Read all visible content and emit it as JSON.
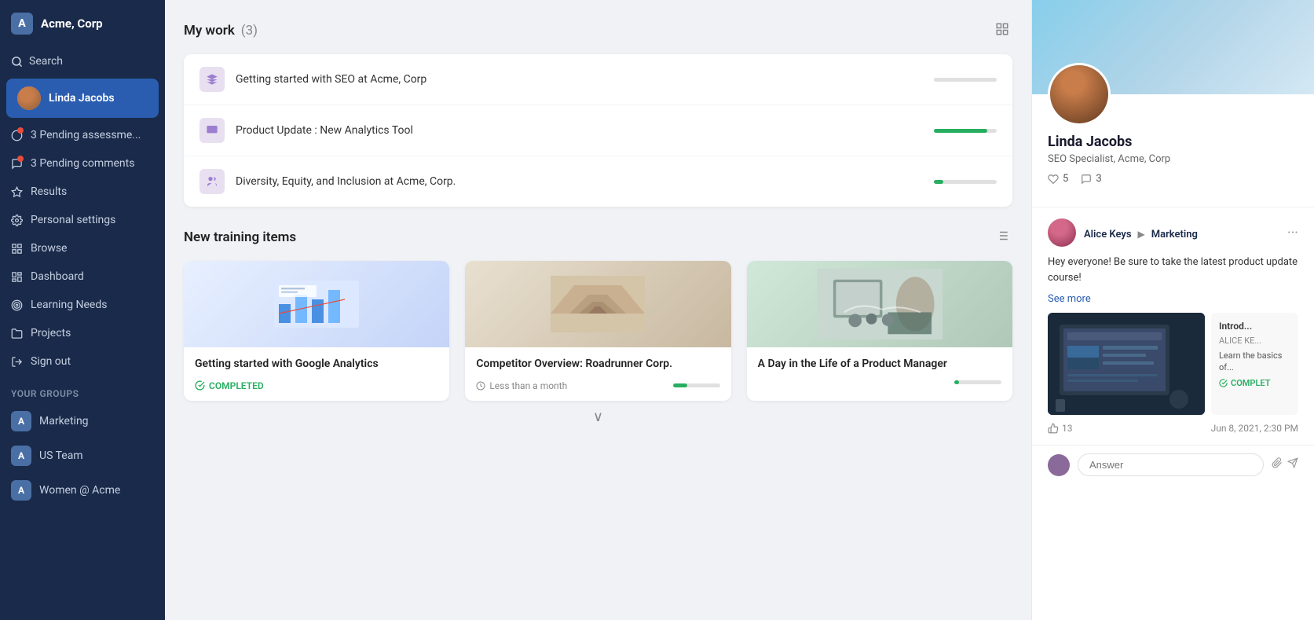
{
  "app": {
    "logo_letter": "A",
    "company_name": "Acme, Corp"
  },
  "sidebar": {
    "search_label": "Search",
    "user_name": "Linda Jacobs",
    "nav_items": [
      {
        "id": "assessments",
        "label": "3 Pending assessme...",
        "has_badge": true,
        "icon": "circle-icon"
      },
      {
        "id": "comments",
        "label": "3 Pending comments",
        "has_badge": true,
        "icon": "comment-icon"
      },
      {
        "id": "results",
        "label": "Results",
        "has_badge": false,
        "icon": "star-icon"
      },
      {
        "id": "personal-settings",
        "label": "Personal settings",
        "has_badge": false,
        "icon": "gear-icon"
      },
      {
        "id": "browse",
        "label": "Browse",
        "has_badge": false,
        "icon": "grid-icon"
      },
      {
        "id": "dashboard",
        "label": "Dashboard",
        "has_badge": false,
        "icon": "dashboard-icon"
      },
      {
        "id": "learning-needs",
        "label": "Learning Needs",
        "has_badge": false,
        "icon": "target-icon"
      },
      {
        "id": "projects",
        "label": "Projects",
        "has_badge": false,
        "icon": "folder-icon"
      },
      {
        "id": "sign-out",
        "label": "Sign out",
        "has_badge": false,
        "icon": "signout-icon"
      }
    ],
    "groups_label": "Your groups",
    "groups": [
      {
        "id": "marketing",
        "label": "Marketing",
        "letter": "A"
      },
      {
        "id": "us-team",
        "label": "US Team",
        "letter": "A"
      },
      {
        "id": "women-at-acme",
        "label": "Women @ Acme",
        "letter": "A"
      }
    ]
  },
  "my_work": {
    "title": "My work",
    "count": "(3)",
    "items": [
      {
        "id": "seo",
        "title": "Getting started with SEO at Acme, Corp",
        "progress": 0,
        "color": "#e0e0e0"
      },
      {
        "id": "analytics-tool",
        "title": "Product Update : New Analytics Tool",
        "progress": 85,
        "color": "#27ae60"
      },
      {
        "id": "diversity",
        "title": "Diversity, Equity, and Inclusion at Acme, Corp.",
        "progress": 15,
        "color": "#27ae60"
      }
    ]
  },
  "new_training": {
    "title": "New training items",
    "items": [
      {
        "id": "google-analytics",
        "title": "Getting started with Google Analytics",
        "status": "COMPLETED",
        "status_type": "completed",
        "time_label": null
      },
      {
        "id": "competitor-overview",
        "title": "Competitor Overview: Roadrunner Corp.",
        "status": null,
        "status_type": "progress",
        "time_label": "Less than a month"
      },
      {
        "id": "product-manager",
        "title": "A Day in the Life of a Product Manager",
        "status": null,
        "status_type": "progress",
        "time_label": null
      }
    ],
    "show_more": "∨"
  },
  "profile": {
    "name": "Linda Jacobs",
    "role": "SEO Specialist, Acme, Corp",
    "hearts": "5",
    "comments": "3"
  },
  "feed_post": {
    "author_name": "Alice Keys",
    "destination": "Marketing",
    "text": "Hey everyone! Be sure to take the latest product update course!",
    "see_more_label": "See more",
    "media_title": "Introd...",
    "media_author": "ALICE KE...",
    "media_desc": "Learn the basics of...",
    "media_completed": "COMPLET",
    "likes": "13",
    "timestamp": "Jun 8, 2021, 2:30 PM"
  },
  "comment": {
    "placeholder": "Answer"
  }
}
